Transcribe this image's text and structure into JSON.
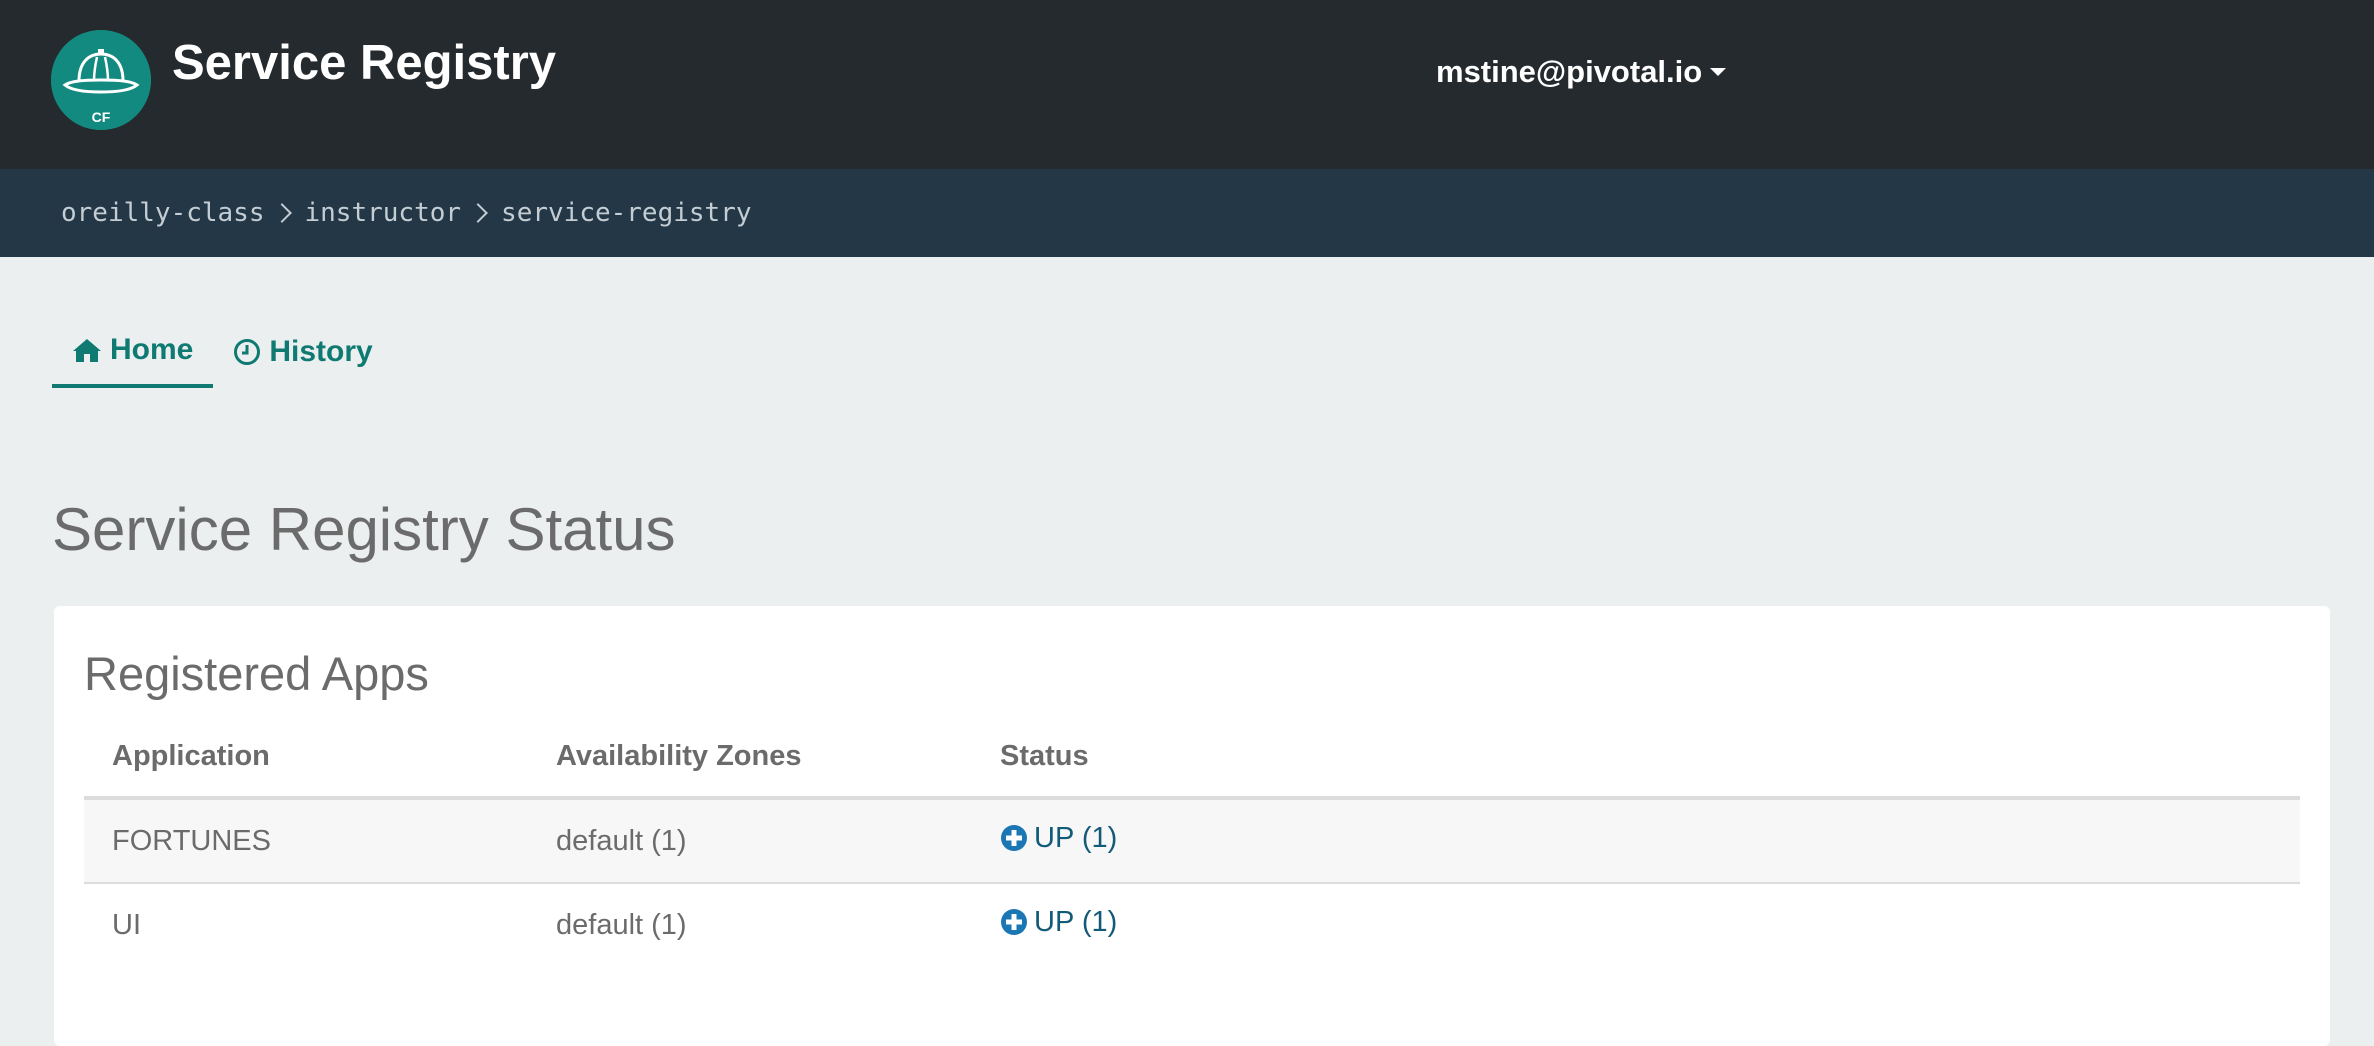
{
  "header": {
    "logo_text": "CF",
    "app_title": "Service Registry",
    "user_email": "mstine@pivotal.io",
    "user_menu_icon": "caret-down-icon"
  },
  "breadcrumb": {
    "items": [
      "oreilly-class",
      "instructor",
      "service-registry"
    ],
    "separator_icon": "chevron-right-icon"
  },
  "tabs": [
    {
      "label": "Home",
      "icon": "home-icon",
      "active": true
    },
    {
      "label": "History",
      "icon": "clock-icon",
      "active": false
    }
  ],
  "main": {
    "page_title": "Service Registry Status",
    "card_title": "Registered Apps",
    "table": {
      "columns": [
        "Application",
        "Availability Zones",
        "Status"
      ],
      "rows": [
        {
          "application": "FORTUNES",
          "zones": "default (1)",
          "status": "UP (1)",
          "status_icon": "plus-circle-icon"
        },
        {
          "application": "UI",
          "zones": "default (1)",
          "status": "UP (1)",
          "status_icon": "plus-circle-icon"
        }
      ]
    }
  },
  "colors": {
    "topbar": "#242a2e",
    "breadcrumb_bar": "#243746",
    "page_background": "#ebeff0",
    "accent": "#0f7a72",
    "logo": "#138a80",
    "status_icon": "#1a77b3"
  }
}
